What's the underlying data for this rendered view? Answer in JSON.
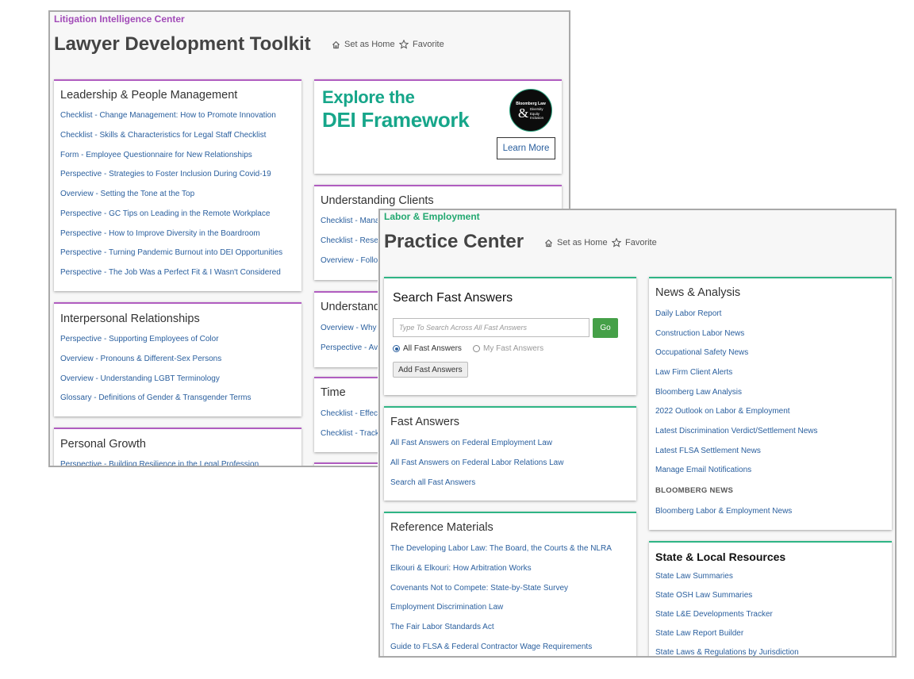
{
  "toolkit": {
    "breadcrumb": "Litigation Intelligence Center",
    "title": "Lawyer Development Toolkit",
    "set_home": "Set as Home",
    "favorite": "Favorite",
    "colors": {
      "accent": "#b05dc0",
      "link": "#2a5f9e"
    },
    "leadership": {
      "title": "Leadership & People Management",
      "links": [
        "Checklist - Change Management: How to Promote Innovation",
        "Checklist - Skills & Characteristics for Legal Staff Checklist",
        "Form - Employee Questionnaire for New Relationships",
        "Perspective - Strategies to Foster Inclusion During Covid-19",
        "Overview - Setting the Tone at the Top",
        "Perspective - GC Tips on Leading in the Remote Workplace",
        "Perspective - How to Improve Diversity in the Boardroom",
        "Perspective - Turning Pandemic Burnout into DEI Opportunities",
        "Perspective - The Job Was a Perfect Fit & I Wasn't Considered"
      ]
    },
    "interpersonal": {
      "title": "Interpersonal Relationships",
      "links": [
        "Perspective - Supporting Employees of Color",
        "Overview - Pronouns & Different-Sex Persons",
        "Overview - Understanding LGBT Terminology",
        "Glossary - Definitions of Gender & Transgender Terms"
      ]
    },
    "growth": {
      "title": "Personal Growth",
      "links": [
        "Perspective - Building Resilience in the Legal Profession"
      ]
    },
    "banner": {
      "line1": "Explore the",
      "line2": "DEI Framework",
      "logo_top": "Bloomberg Law",
      "logo_amp": "&",
      "logo_words": [
        "Diversity",
        "Equity",
        "Inclusion"
      ],
      "button": "Learn More"
    },
    "clients": {
      "title": "Understanding Clients",
      "links": [
        "Checklist - Mana",
        "Checklist - Resea",
        "Overview - Follo"
      ]
    },
    "understanding2": {
      "title": "Understand",
      "links": [
        "Overview - Why",
        "Perspective - Av"
      ]
    },
    "time": {
      "title": "Time",
      "links": [
        "Checklist - Effect",
        "Checklist - Track"
      ]
    }
  },
  "practice": {
    "breadcrumb": "Labor & Employment",
    "title": "Practice Center",
    "set_home": "Set as Home",
    "favorite": "Favorite",
    "colors": {
      "accent": "#2fb585",
      "go_button": "#45a048",
      "link": "#2a5f9e"
    },
    "search": {
      "title": "Search Fast Answers",
      "placeholder": "Type To Search Across All Fast Answers",
      "go": "Go",
      "radio_all": "All Fast Answers",
      "radio_mine": "My Fast Answers",
      "selected": "All Fast Answers",
      "add": "Add Fast Answers"
    },
    "fast_answers": {
      "title": "Fast Answers",
      "links": [
        "All Fast Answers on Federal Employment Law",
        "All Fast Answers on Federal Labor Relations Law",
        "Search all Fast Answers"
      ]
    },
    "reference": {
      "title": "Reference Materials",
      "links": [
        "The Developing Labor Law: The Board, the Courts & the NLRA",
        "Elkouri & Elkouri: How Arbitration Works",
        "Covenants Not to Compete: State-by-State Survey",
        "Employment Discrimination Law",
        "The Fair Labor Standards Act",
        "Guide to FLSA & Federal Contractor Wage Requirements"
      ]
    },
    "news": {
      "title": "News & Analysis",
      "links": [
        "Daily Labor Report",
        "Construction Labor News",
        "Occupational Safety News",
        "Law Firm Client Alerts",
        "Bloomberg Law Analysis",
        "2022 Outlook on Labor & Employment",
        "Latest Discrimination Verdict/Settlement News",
        "Latest FLSA Settlement News",
        "Manage Email Notifications"
      ],
      "section_label": "BLOOMBERG NEWS",
      "section_links": [
        "Bloomberg Labor & Employment News"
      ]
    },
    "state": {
      "title": "State & Local Resources",
      "links": [
        "State Law Summaries",
        "State OSH Law Summaries",
        "State L&E Developments Tracker",
        "State Law Report Builder",
        "State Laws & Regulations by Jurisdiction"
      ]
    }
  }
}
